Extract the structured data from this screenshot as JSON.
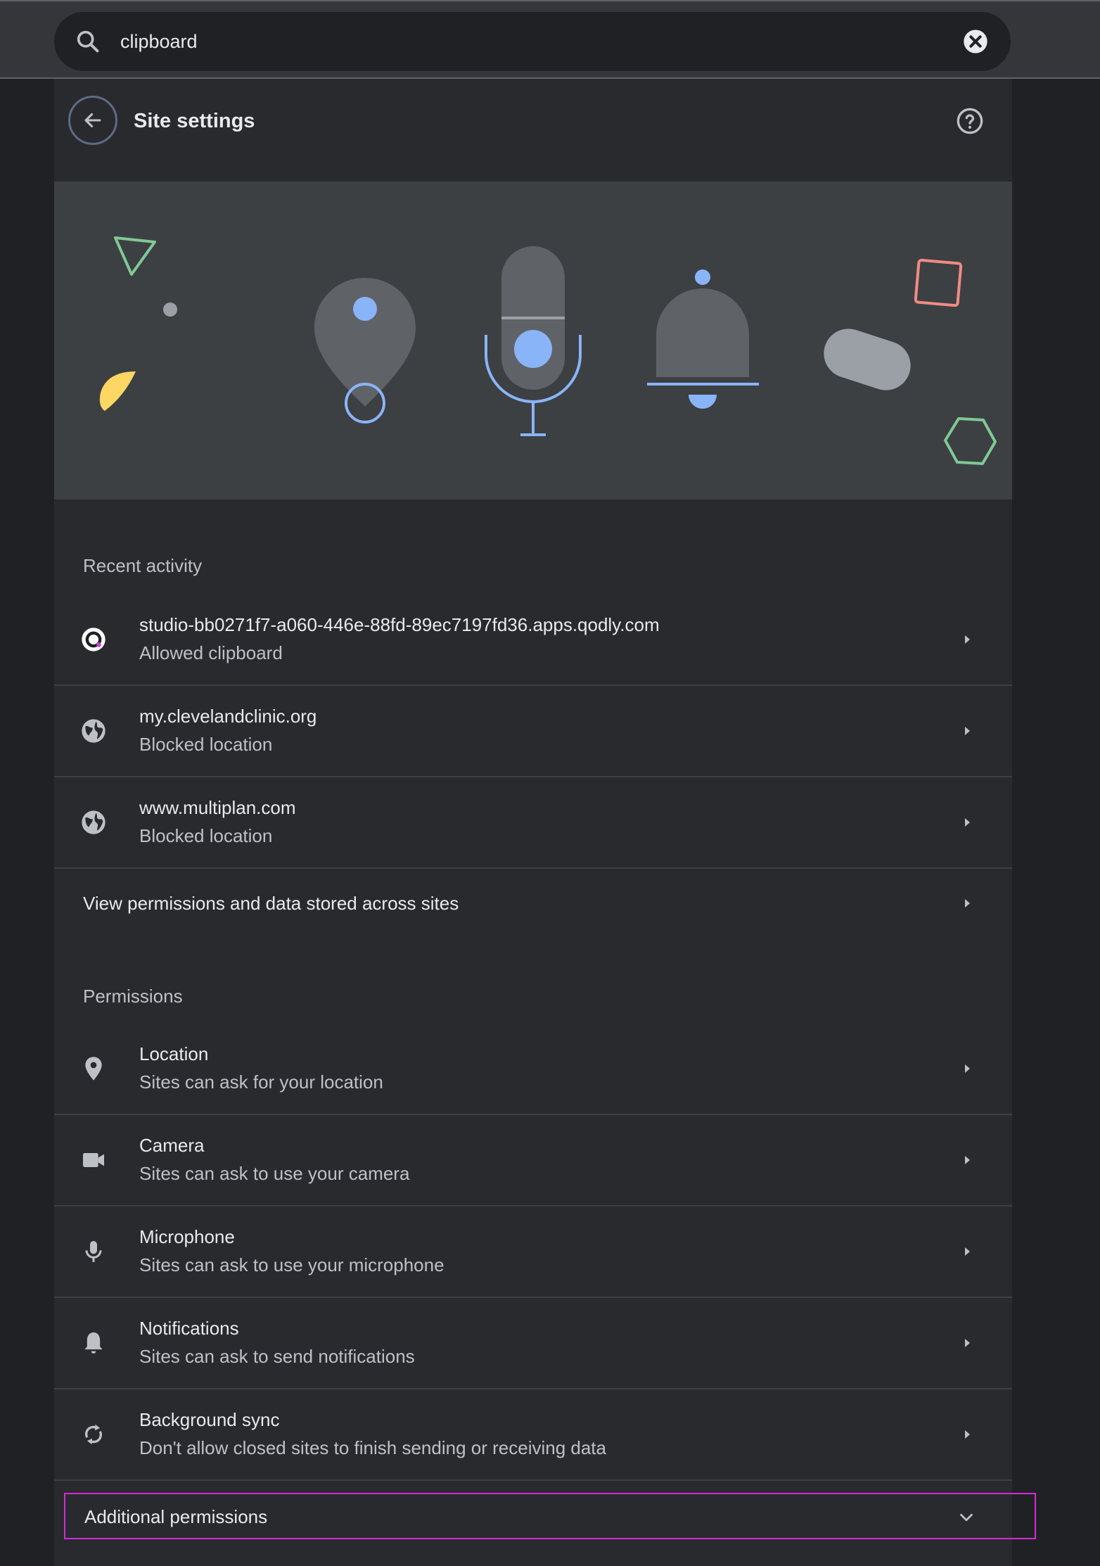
{
  "search": {
    "value": "clipboard",
    "icon": "search-icon",
    "clear_icon": "clear-icon"
  },
  "header": {
    "title": "Site settings",
    "back_icon": "arrow-back-icon",
    "help_icon": "help-icon"
  },
  "colors": {
    "background": "#202124",
    "card": "#292a2d",
    "banner": "#3c4043",
    "accent_blue": "#8ab4f8",
    "illustration_gray": "#5f6368",
    "yellow": "#fdd663",
    "green": "#81c995",
    "red": "#f28b82",
    "highlight": "#d32bd9"
  },
  "recent_activity": {
    "label": "Recent activity",
    "items": [
      {
        "title": "studio-bb0271f7-a060-446e-88fd-89ec7197fd36.apps.qodly.com",
        "subtitle": "Allowed clipboard",
        "icon": "site-favicon-icon"
      },
      {
        "title": "my.clevelandclinic.org",
        "subtitle": "Blocked location",
        "icon": "globe-icon"
      },
      {
        "title": "www.multiplan.com",
        "subtitle": "Blocked location",
        "icon": "globe-icon"
      }
    ],
    "view_all": "View permissions and data stored across sites"
  },
  "permissions": {
    "label": "Permissions",
    "items": [
      {
        "title": "Location",
        "subtitle": "Sites can ask for your location",
        "icon": "location-pin-icon"
      },
      {
        "title": "Camera",
        "subtitle": "Sites can ask to use your camera",
        "icon": "camera-icon"
      },
      {
        "title": "Microphone",
        "subtitle": "Sites can ask to use your microphone",
        "icon": "microphone-icon"
      },
      {
        "title": "Notifications",
        "subtitle": "Sites can ask to send notifications",
        "icon": "bell-icon"
      },
      {
        "title": "Background sync",
        "subtitle": "Don't allow closed sites to finish sending or receiving data",
        "icon": "sync-icon"
      }
    ],
    "additional": "Additional permissions"
  }
}
